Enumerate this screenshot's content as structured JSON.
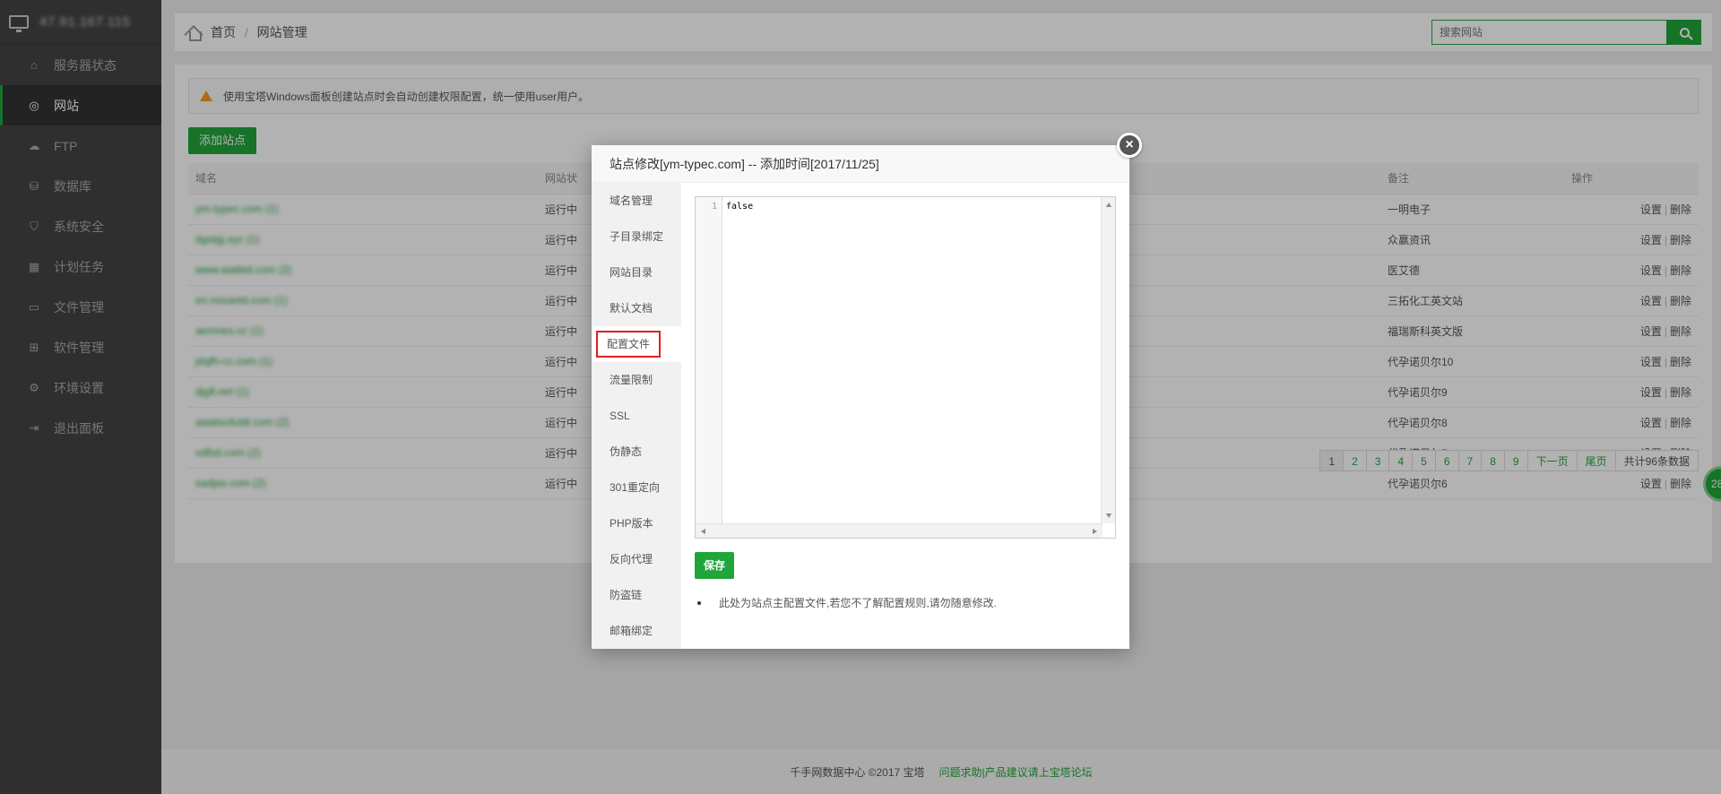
{
  "server": {
    "ip": "47.91.167.115"
  },
  "sidebar": {
    "items": [
      {
        "label": "服务器状态",
        "icon": "home-icon"
      },
      {
        "label": "网站",
        "icon": "globe-icon",
        "active": true
      },
      {
        "label": "FTP",
        "icon": "cloud-icon"
      },
      {
        "label": "数据库",
        "icon": "database-icon"
      },
      {
        "label": "系统安全",
        "icon": "shield-icon"
      },
      {
        "label": "计划任务",
        "icon": "calendar-icon"
      },
      {
        "label": "文件管理",
        "icon": "folder-icon"
      },
      {
        "label": "软件管理",
        "icon": "grid-icon"
      },
      {
        "label": "环境设置",
        "icon": "gear-icon"
      },
      {
        "label": "退出面板",
        "icon": "logout-icon"
      }
    ]
  },
  "breadcrumb": {
    "home": "首页",
    "sep": "/",
    "current": "网站管理"
  },
  "search": {
    "placeholder": "搜索网站"
  },
  "notice": {
    "text": "使用宝塔Windows面板创建站点时会自动创建权限配置，统一使用user用户。"
  },
  "add_site_label": "添加站点",
  "table": {
    "headers": {
      "domain": "域名",
      "status": "网站状",
      "remark": "备注",
      "ops": "操作"
    },
    "rows": [
      {
        "domain": "ym-typec.com (1)",
        "status": "运行中",
        "remark": "一明电子"
      },
      {
        "domain": "dgstgj.xyz (1)",
        "status": "运行中",
        "remark": "众赢资讯"
      },
      {
        "domain": "www.aiaibid.com (2)",
        "status": "运行中",
        "remark": "医艾德"
      },
      {
        "domain": "en.nssantd.com (1)",
        "status": "运行中",
        "remark": "三拓化工英文站"
      },
      {
        "domain": "aemnes.cc (1)",
        "status": "运行中",
        "remark": "福瑞斯科英文版"
      },
      {
        "domain": "jdqfh-cc.com (1)",
        "status": "运行中",
        "remark": "代孕诺贝尔10"
      },
      {
        "domain": "djgfl.net (1)",
        "status": "运行中",
        "remark": "代孕诺贝尔9"
      },
      {
        "domain": "aiaatsofuldi.com (2)",
        "status": "运行中",
        "remark": "代孕诺贝尔8"
      },
      {
        "domain": "vdfsd.com (2)",
        "status": "运行中",
        "remark": "代孕诺贝尔7"
      },
      {
        "domain": "sadjas.com (2)",
        "status": "运行中",
        "remark": "代孕诺贝尔6"
      }
    ],
    "op_set": "设置",
    "op_sep": "|",
    "op_del": "删除"
  },
  "pager": {
    "pages": [
      "1",
      "2",
      "3",
      "4",
      "5",
      "6",
      "7",
      "8",
      "9"
    ],
    "next": "下一页",
    "last": "尾页",
    "total": "共计96条数据"
  },
  "footer": {
    "copyright": "千手网数据中心 ©2017 宝塔",
    "link": "问题求助|产品建议请上宝塔论坛"
  },
  "side_badge": "28",
  "modal": {
    "title": "站点修改[ym-typec.com] -- 添加时间[2017/11/25]",
    "close": "×",
    "nav": [
      "域名管理",
      "子目录绑定",
      "网站目录",
      "默认文档",
      "配置文件",
      "流量限制",
      "SSL",
      "伪静态",
      "301重定向",
      "PHP版本",
      "反向代理",
      "防盗链",
      "邮箱绑定"
    ],
    "active_nav": 4,
    "editor": {
      "line": "1",
      "content": "false"
    },
    "save_label": "保存",
    "tip": "此处为站点主配置文件,若您不了解配置规则,请勿随意修改."
  },
  "colors": {
    "accent": "#20a53a",
    "sidebar": "#444444",
    "highlight": "#e02020"
  }
}
